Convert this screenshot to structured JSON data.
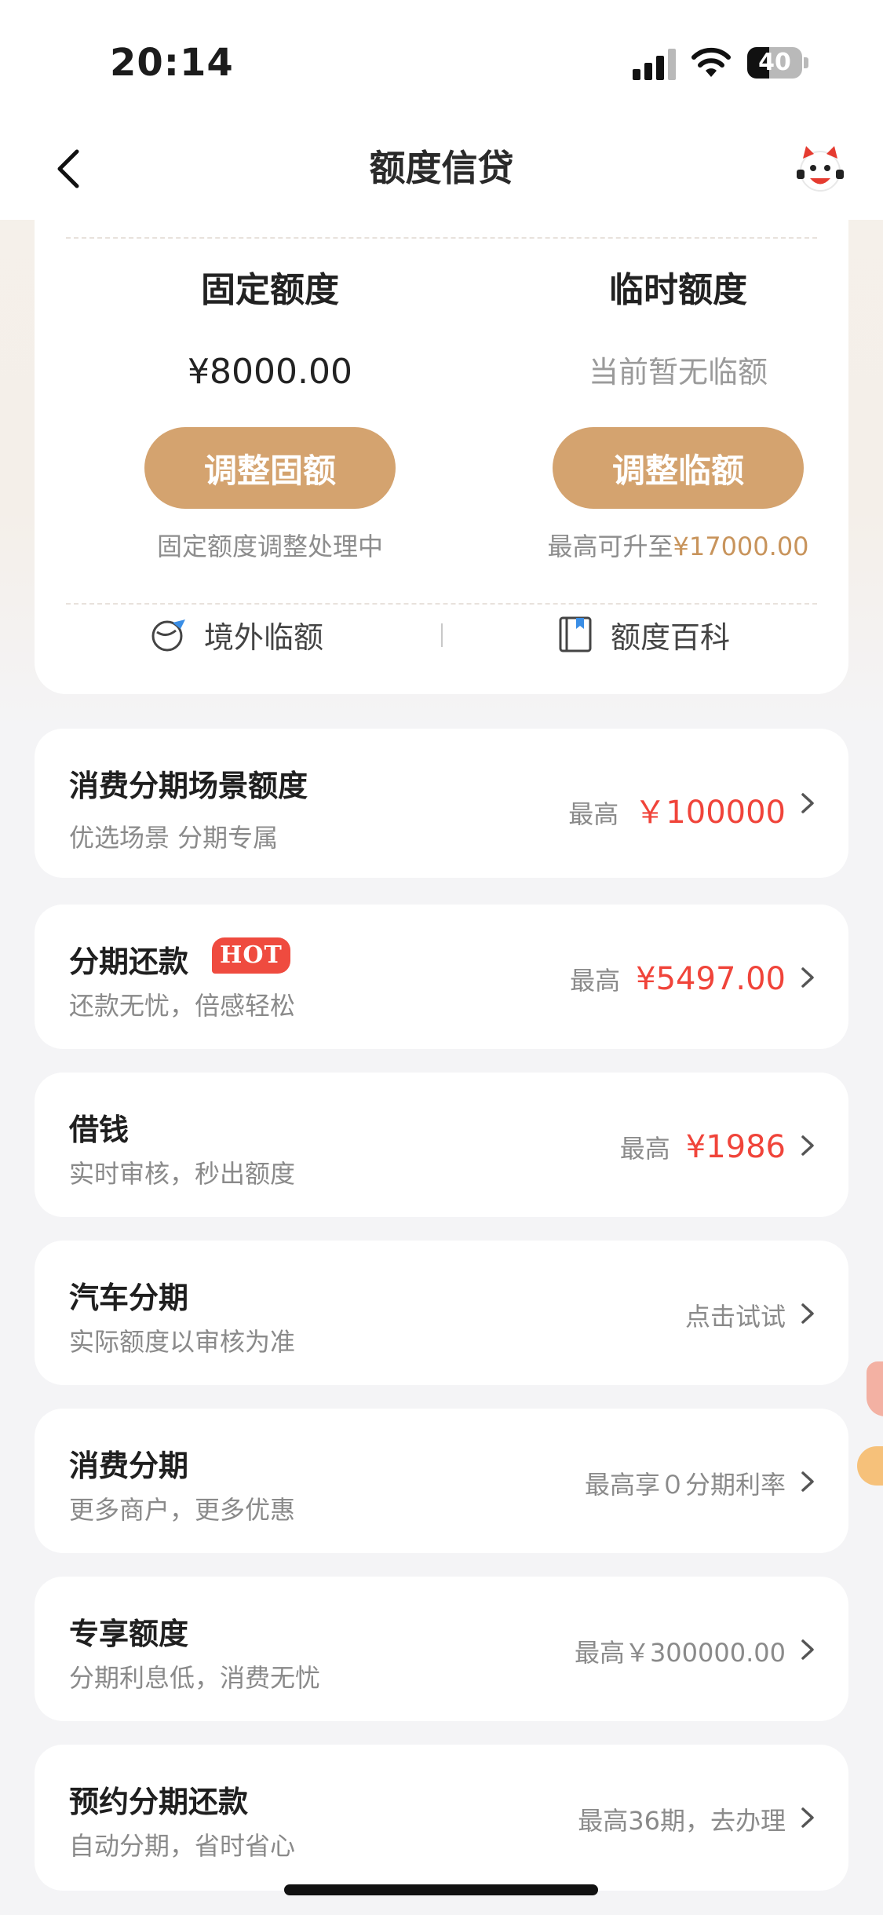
{
  "status_bar": {
    "time": "20:14",
    "battery": "40",
    "battery_level": 0.4
  },
  "nav": {
    "title": "额度信贷",
    "back_icon": "chevron-left-icon",
    "mascot_icon": "mascot-cat-icon"
  },
  "quota": {
    "fixed": {
      "title": "固定额度",
      "value": "¥8000.00",
      "button": "调整固额",
      "note": "固定额度调整处理中"
    },
    "temp": {
      "title": "临时额度",
      "value": "当前暂无临额",
      "button": "调整临额",
      "note_prefix": "最高可升至",
      "note_amount": "¥17000.00"
    },
    "links": [
      {
        "label": "境外临额",
        "icon": "globe-plane-icon"
      },
      {
        "label": "额度百科",
        "icon": "book-icon"
      }
    ]
  },
  "rows": [
    {
      "title": "消费分期场景额度",
      "subtitle": "优选场景 分期专属",
      "right_label": "最高",
      "amount": "￥100000"
    },
    {
      "title": "分期还款",
      "badge": "HOT",
      "subtitle": "还款无忧，倍感轻松",
      "right_label": "最高",
      "amount": "¥5497.00"
    },
    {
      "title": "借钱",
      "subtitle": "实时审核，秒出额度",
      "right_label": "最高",
      "amount": "¥1986"
    },
    {
      "title": "汽车分期",
      "subtitle": "实际额度以审核为准",
      "right_label": "点击试试"
    },
    {
      "title": "消费分期",
      "subtitle": "更多商户，更多优惠",
      "right_label": "最高享０分期利率"
    },
    {
      "title": "专享额度",
      "subtitle": "分期利息低，消费无忧",
      "right_label": "最高￥300000.00"
    },
    {
      "title": "预约分期还款",
      "subtitle": "自动分期，省时省心",
      "right_label": "最高36期，去办理"
    }
  ],
  "colors": {
    "accent_gold": "#d4a36f",
    "amount_red": "#f0443a",
    "hot_badge": "#ef4b3f"
  }
}
